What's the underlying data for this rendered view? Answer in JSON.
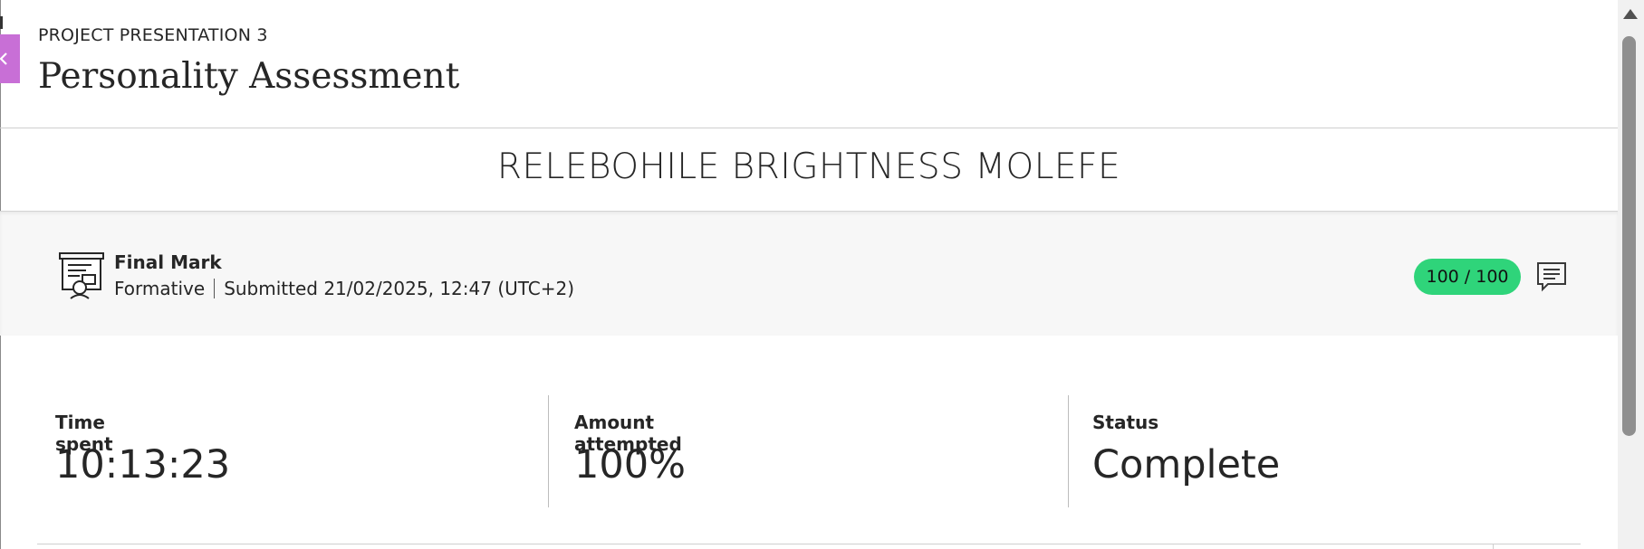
{
  "header": {
    "eyebrow": "PROJECT PRESENTATION 3",
    "title": "Personality Assessment"
  },
  "student": {
    "name": "RELEBOHILE BRIGHTNESS MOLEFE"
  },
  "mark": {
    "label": "Final Mark",
    "type": "Formative",
    "submitted": "Submitted 21/02/2025, 12:47 (UTC+2)",
    "score": "100 / 100",
    "score_color": "#2fd47a"
  },
  "stats": [
    {
      "label": "Time spent",
      "value": "10:13:23"
    },
    {
      "label": "Amount attempted",
      "value": "100%"
    },
    {
      "label": "Status",
      "value": "Complete"
    }
  ],
  "colors": {
    "close_tab": "#c86fd6"
  },
  "icons": {
    "close": "close-icon",
    "mark": "certificate-presentation-icon",
    "feedback": "feedback-comment-icon",
    "scroll_up": "scroll-up-arrow-icon"
  }
}
